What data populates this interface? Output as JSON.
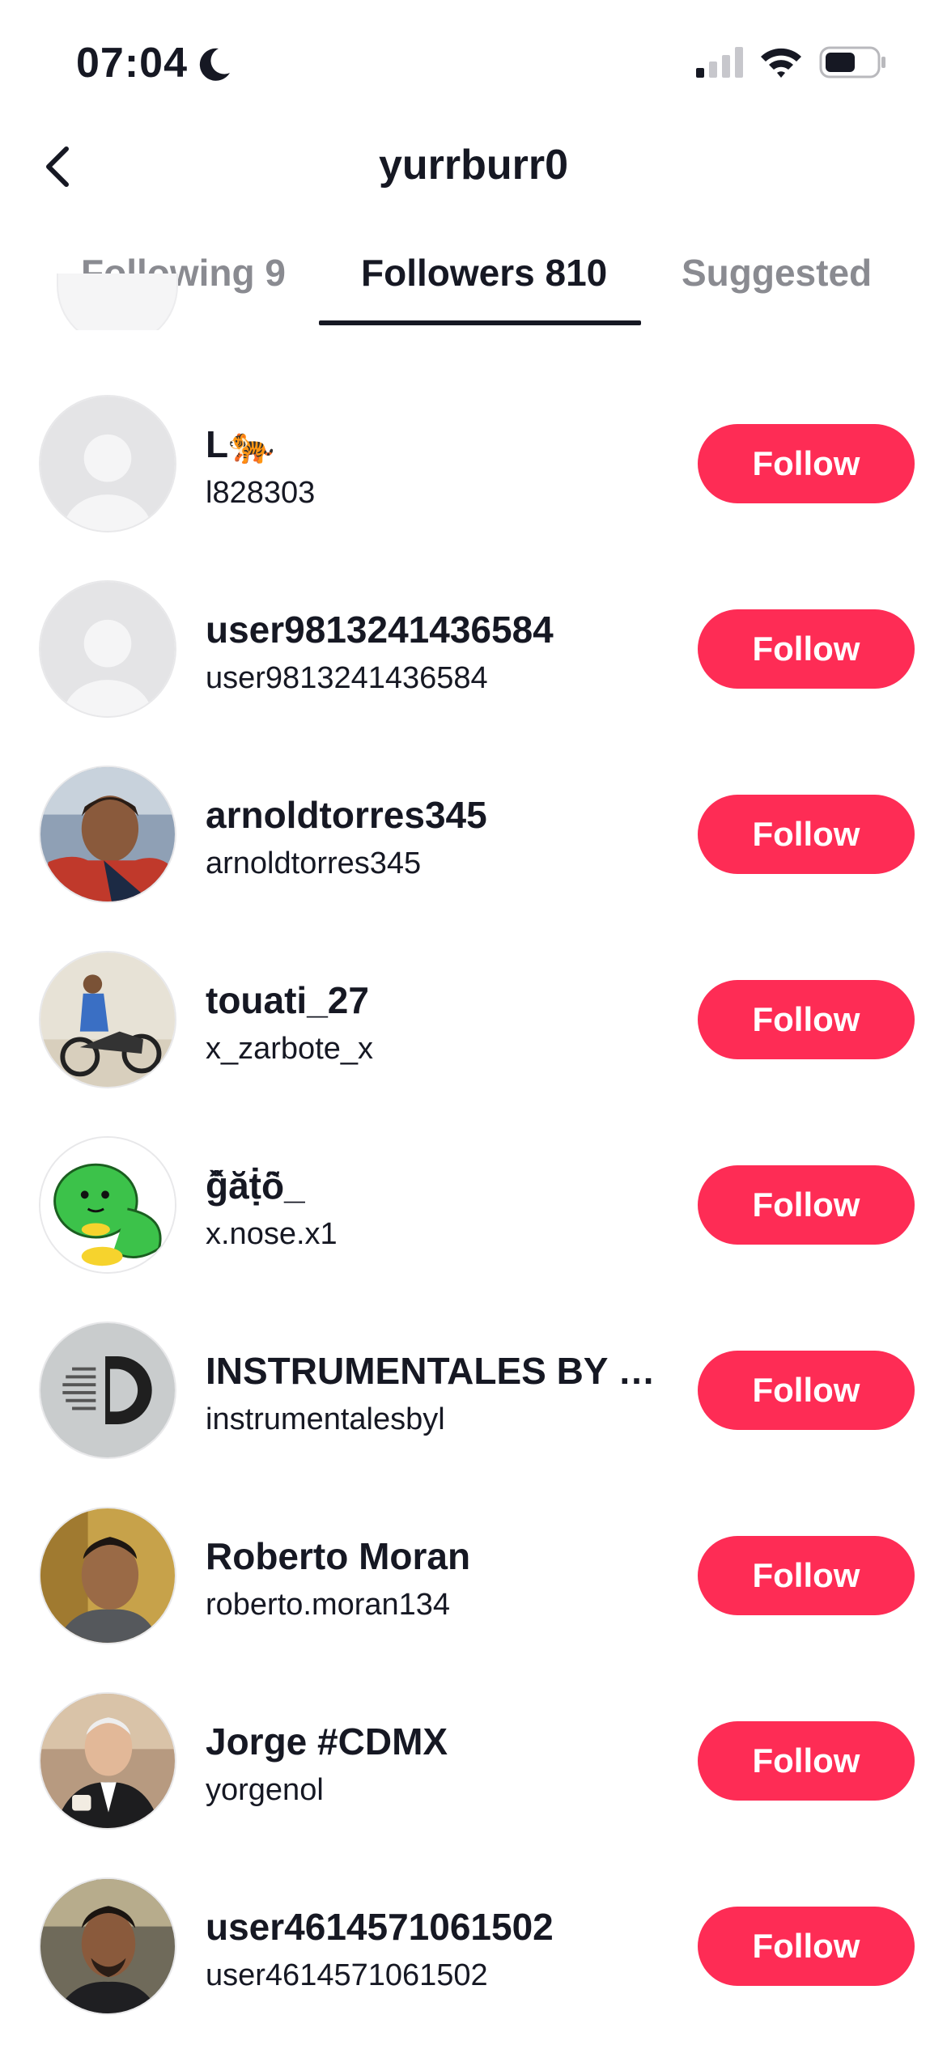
{
  "status_bar": {
    "time": "07:04"
  },
  "header": {
    "title": "yurrburr0"
  },
  "tabs": [
    {
      "label": "Following 9"
    },
    {
      "label": "Followers 810"
    },
    {
      "label": "Suggested"
    }
  ],
  "followers": [
    {
      "name": "L🐅",
      "handle": "l828303",
      "button": "Follow",
      "avatar": "default"
    },
    {
      "name": "user9813241436584",
      "handle": "user9813241436584",
      "button": "Follow",
      "avatar": "default"
    },
    {
      "name": "arnoldtorres345",
      "handle": "arnoldtorres345",
      "button": "Follow",
      "avatar": "photo"
    },
    {
      "name": "touati_27",
      "handle": "x_zarbote_x",
      "button": "Follow",
      "avatar": "photo"
    },
    {
      "name": "ĝ̌ăṭ̇ȏ̃_",
      "handle": "x.nose.x1",
      "button": "Follow",
      "avatar": "cartoon"
    },
    {
      "name": "INSTRUMENTALES BY LE...",
      "handle": "instrumentalesbyl",
      "button": "Follow",
      "avatar": "logo"
    },
    {
      "name": "Roberto Moran",
      "handle": "roberto.moran134",
      "button": "Follow",
      "avatar": "photo"
    },
    {
      "name": "Jorge #CDMX",
      "handle": "yorgenol",
      "button": "Follow",
      "avatar": "photo"
    },
    {
      "name": "user4614571061502",
      "handle": "user4614571061502",
      "button": "Follow",
      "avatar": "photo"
    }
  ],
  "colors": {
    "accent": "#fe2c55",
    "text": "#161823",
    "muted": "#8a8b91"
  }
}
